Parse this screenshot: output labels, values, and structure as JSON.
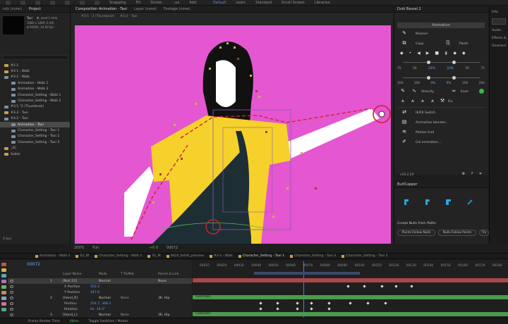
{
  "toolbar": {
    "snapping": "Snapping",
    "fill": "Fill",
    "stroke": "Stroke:",
    "stroke_px": "- px",
    "add": "Add",
    "workspaces": [
      "Default",
      "Learn",
      "Standard",
      "Small Screen",
      "Libraries"
    ]
  },
  "project": {
    "tabs": [
      "rols (none)",
      "Project"
    ],
    "active_tab": "Project",
    "selected_name": "Taxi",
    "selected_used": "▼, used 1 time",
    "info_line_1": "1080 x 1080 (1.00)",
    "info_line_2": "Δ 00260, 24.00 fps",
    "items": [
      {
        "name": "#1-1",
        "kind": "folder"
      },
      {
        "name": "#3-1 - Walk",
        "kind": "folder"
      },
      {
        "name": "#3-1 - Walk",
        "kind": "comp"
      },
      {
        "name": "Animation - Walk 1",
        "kind": "comp"
      },
      {
        "name": "Animation - Walk 2",
        "kind": "comp"
      },
      {
        "name": "Character_Setting - Walk 1",
        "kind": "comp"
      },
      {
        "name": "Character_Setting - Walk 2",
        "kind": "comp"
      },
      {
        "name": "#3-1 \"2 (Thumbnail)",
        "kind": "comp"
      },
      {
        "name": "#3-2 - Taxi",
        "kind": "folder"
      },
      {
        "name": "#3-2 - Taxi",
        "kind": "comp"
      },
      {
        "name": "Animation - Taxi",
        "kind": "comp"
      },
      {
        "name": "Character_Setting - Taxi 1",
        "kind": "comp"
      },
      {
        "name": "Character_Setting - Taxi 2",
        "kind": "comp"
      },
      {
        "name": "Character_Setting - Taxi 3",
        "kind": "comp"
      },
      {
        "name": "_SC",
        "kind": "folder"
      },
      {
        "name": "Solids",
        "kind": "folder"
      }
    ],
    "selected_index": 10,
    "footer_bpc": "8 bpc"
  },
  "comp": {
    "tabs": [
      "Composition Animation - Taxi",
      "Layer (none)",
      "Footage (none)"
    ],
    "crumbs": [
      "#3-1 - 2 (Thumbnail)",
      "#3-2 - Taxi"
    ],
    "footer": {
      "zoom": "200%",
      "quality": "Full",
      "exposure": "+0.0",
      "frame": "00072"
    }
  },
  "duik": {
    "title": "Duik Bassel.2",
    "mode": "Animation",
    "row1": [
      "Kleaner"
    ],
    "row2": [
      "Copy",
      "Paste"
    ],
    "nums_a": [
      "75",
      "50",
      "33%",
      "33%",
      "50",
      "75"
    ],
    "nums_b": [
      "200",
      "100",
      "0%",
      "0%",
      "100",
      "200"
    ],
    "row_v": [
      "Velocity",
      "Ease"
    ],
    "fix": "Fix",
    "tools": [
      "IK/FK Switch",
      "Animation blender...",
      "Motion trail",
      "Cel animation..."
    ],
    "version": "v16.2.29"
  },
  "right_strip": [
    "Info",
    "Audio",
    "Effects &",
    "Overlord"
  ],
  "buttcapper": {
    "title": "ButtCapper",
    "nulls_title": "Create Nulls From Paths",
    "buttons": [
      "Points Follow Nulls",
      "Nulls Follow Points",
      "Tra"
    ]
  },
  "timeline": {
    "tabs": [
      "Animation - Walk 2",
      "S3_W",
      "Character_Setting - Walk 1",
      "S1_M",
      "0024_0LIVE_preview",
      "#3-1 - Walk",
      "Character_Setting - Taxi 1",
      "Character_Setting - Taxi 3",
      "Character_Setting - Taxi 2"
    ],
    "active_tab": "Character_Setting - Taxi 1",
    "timecode": "00072",
    "headers": {
      "name": "Layer Name",
      "mode": "Mode",
      "trkmat": "T TrkMat",
      "parent": "Parent & Link"
    },
    "rows": [
      {
        "num": "1",
        "name": "[Null 23]",
        "mode": "Normal",
        "trk": "",
        "parent": "None",
        "sel": true
      },
      {
        "num": "",
        "name": "X Position",
        "val": "502.2",
        "sub": true
      },
      {
        "num": "",
        "name": "Y Position",
        "val": "447.6",
        "sub": true
      },
      {
        "num": "2",
        "name": "[Hand_R]",
        "mode": "Normal",
        "trk": "None",
        "parent": "36. Hip",
        "sel": false
      },
      {
        "num": "",
        "name": "Position",
        "val": "254.7, 368.3",
        "sub": true
      },
      {
        "num": "",
        "name": "Rotation",
        "val": "0x -18.0°",
        "sub": true
      },
      {
        "num": "3",
        "name": "[Hand_L]",
        "mode": "Normal",
        "trk": "None",
        "parent": "36. Hip",
        "sel": false
      }
    ],
    "ruler": [
      "00010",
      "00020",
      "00030",
      "00040",
      "00050",
      "00060",
      "00070",
      "00080",
      "00090",
      "00100",
      "00110",
      "00120",
      "00130",
      "00140",
      "00150",
      "00160",
      "00170",
      "00180"
    ],
    "bar_labels": [
      "Controller",
      "Controller"
    ],
    "footer": {
      "render": "Frame Render Time",
      "render_val": "48ms",
      "toggle": "Toggle Switches / Modes"
    }
  },
  "colors": {
    "canvas": "#e556d1",
    "shirt": "#f6d12b",
    "accent_blue": "#5b8ee6",
    "red": "#d0202c",
    "bar_green": "#4c9a4b",
    "bar_red": "#a8474a"
  }
}
